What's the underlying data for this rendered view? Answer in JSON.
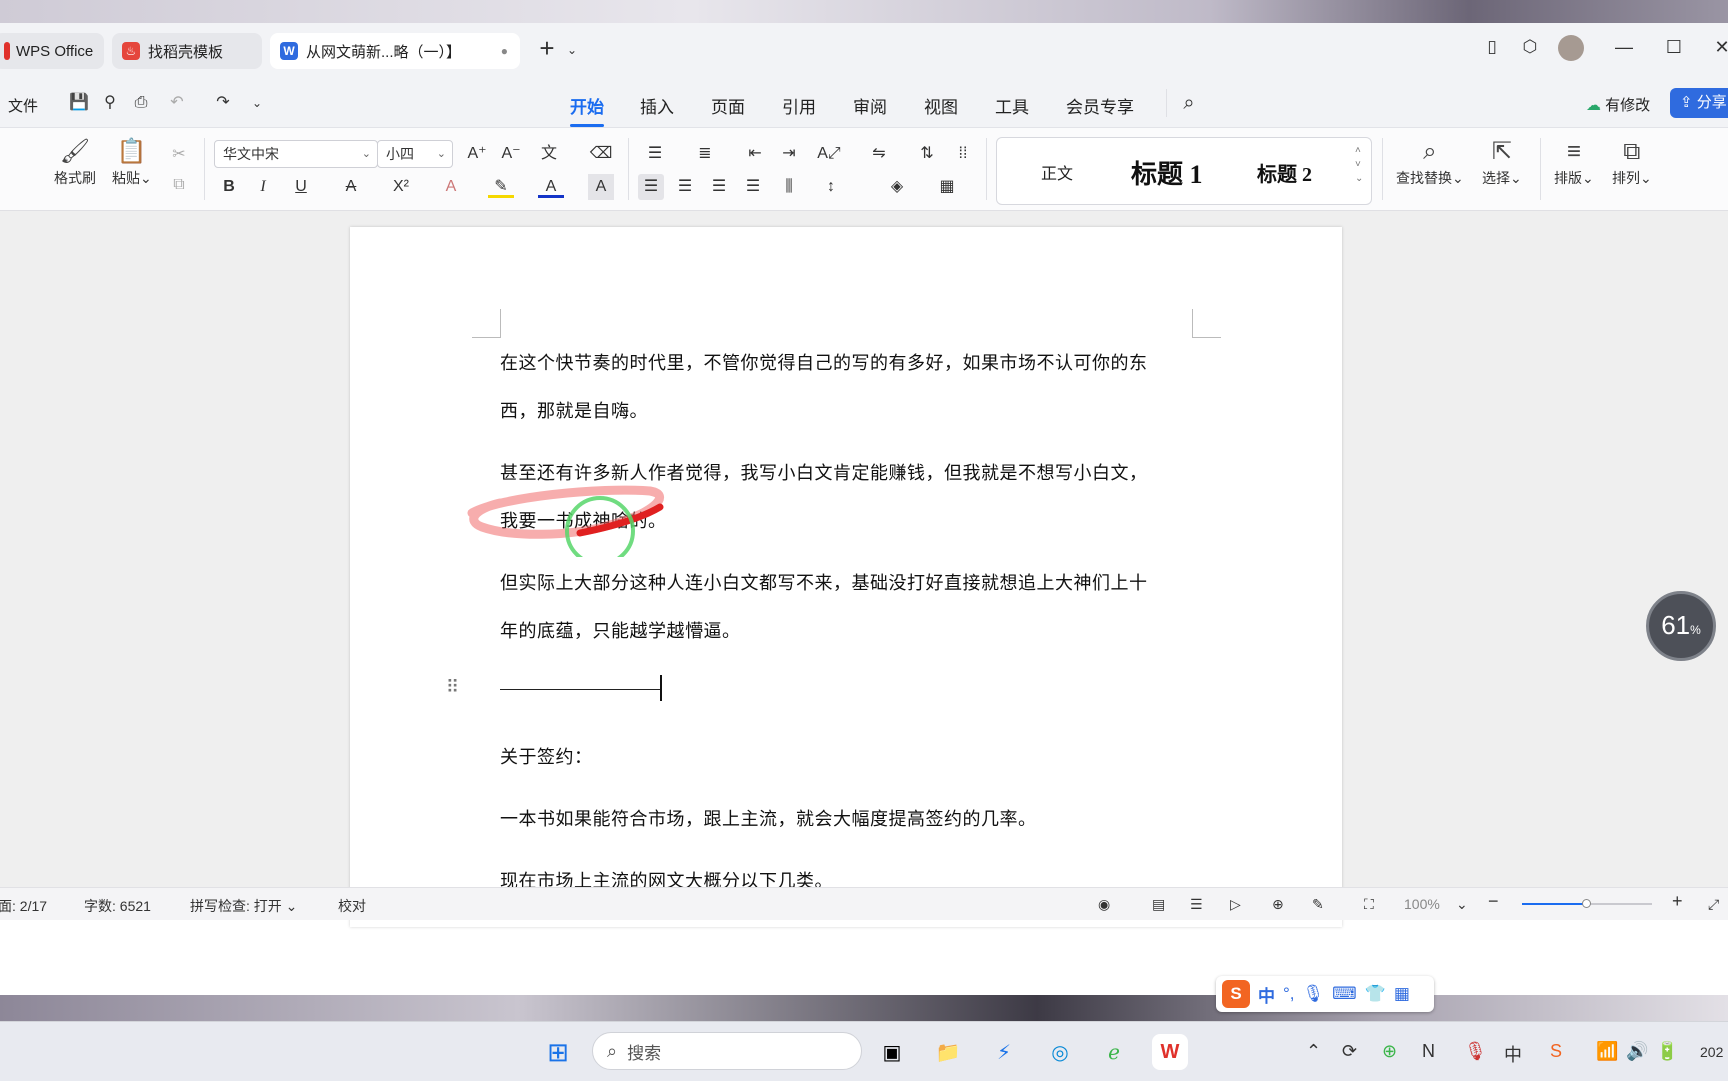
{
  "tabs": [
    {
      "label": "WPS Office"
    },
    {
      "label": "找稻壳模板"
    },
    {
      "label": "从网文萌新...略（一）】"
    }
  ],
  "menu": {
    "file": "文件",
    "items": [
      "开始",
      "插入",
      "页面",
      "引用",
      "审阅",
      "视图",
      "工具",
      "会员专享"
    ],
    "active": "开始",
    "modified": "有修改",
    "share": "分享"
  },
  "ribbon": {
    "format_painter": "格式刷",
    "paste": "粘贴",
    "font_name": "华文中宋",
    "font_size": "小四",
    "styles": {
      "normal": "正文",
      "h1": "标题 1",
      "h2": "标题 2"
    },
    "find_replace": "查找替换",
    "select": "选择",
    "layout": "排版",
    "arrange": "排列"
  },
  "document": {
    "paragraphs": [
      "在这个快节奏的时代里，不管你觉得自己的写的有多好，如果市场不认可你的东",
      "西，那就是自嗨。",
      "甚至还有许多新人作者觉得，我写小白文肯定能赚钱，但我就是不想写小白文，",
      "我要一书成神啥的。",
      "但实际上大部分这种人连小白文都写不来，基础没打好直接就想追上大神们上十",
      "年的底蕴，只能越学越懵逼。",
      "关于签约：",
      "一本书如果能符合市场，跟上主流，就会大幅度提高签约的几率。",
      "现在市场上主流的网文大概分以下几类。"
    ]
  },
  "progress_widget": {
    "value": "61",
    "unit": "%"
  },
  "status": {
    "page": "面: 2/17",
    "word_count": "字数: 6521",
    "spell_check": "拼写检查: 打开",
    "proofread": "校对",
    "zoom": "100%"
  },
  "taskbar": {
    "search_placeholder": "搜索",
    "ime_label": "中",
    "clock_partial": "202"
  }
}
